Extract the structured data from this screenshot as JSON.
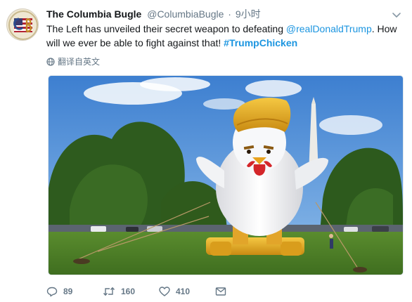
{
  "tweet": {
    "display_name": "The Columbia Bugle",
    "screen_name": "@ColumbiaBugle",
    "separator": "·",
    "timestamp": "9小时",
    "text_parts": {
      "before_mention": "The Left has unveiled their secret weapon to defeating ",
      "mention": "@realDonaldTrump",
      "after_mention": ". How will we ever be able to fight against that! ",
      "hashtag": "#TrumpChicken"
    },
    "translate_label": "翻译自英文",
    "media_description": "Inflatable white chicken with golden hair on a lawn near the Washington Monument",
    "counts": {
      "replies": "89",
      "retweets": "160",
      "likes": "410"
    }
  },
  "colors": {
    "link": "#1b95e0",
    "secondary_text": "#657786",
    "primary_text": "#14171a"
  },
  "icons": [
    "caret-down-icon",
    "globe-icon",
    "reply-icon",
    "retweet-icon",
    "heart-icon",
    "envelope-icon"
  ]
}
